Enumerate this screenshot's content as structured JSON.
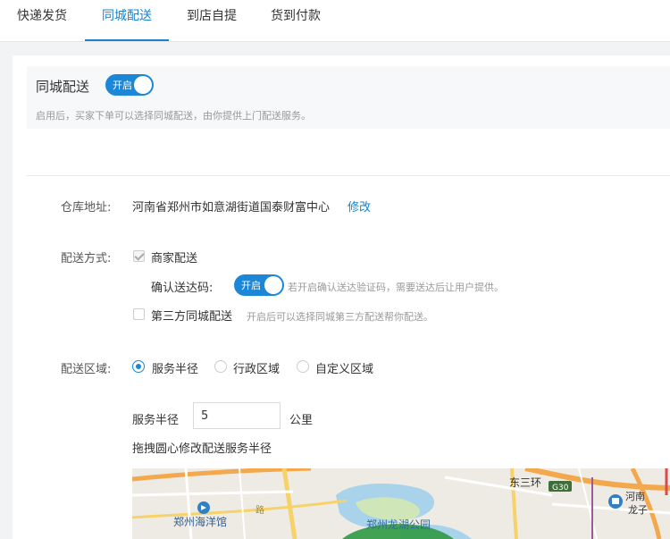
{
  "tabs": [
    {
      "label": "快递发货"
    },
    {
      "label": "同城配送"
    },
    {
      "label": "到店自提"
    },
    {
      "label": "货到付款"
    }
  ],
  "section": {
    "title": "同城配送",
    "switch_label": "开启",
    "description": "启用后，买家下单可以选择同城配送，由你提供上门配送服务。"
  },
  "warehouse": {
    "label": "仓库地址:",
    "address": "河南省郑州市如意湖街道国泰财富中心",
    "edit_link": "修改"
  },
  "delivery_method": {
    "label": "配送方式:",
    "merchant": "商家配送",
    "confirm_code_label": "确认送达码:",
    "confirm_switch_label": "开启",
    "confirm_hint": "若开启确认送达验证码，需要送达后让用户提供。",
    "third_party": "第三方同城配送",
    "third_party_hint": "开启后可以选择同城第三方配送帮你配送。"
  },
  "delivery_area": {
    "label": "配送区域:",
    "options": [
      {
        "label": "服务半径"
      },
      {
        "label": "行政区域"
      },
      {
        "label": "自定义区域"
      }
    ],
    "radius_label": "服务半径",
    "radius_value": "5",
    "radius_unit": "公里",
    "drag_hint": "拖拽圆心修改配送服务半径"
  },
  "map": {
    "labels": {
      "museum": "郑州海洋馆",
      "park": "郑州龙湖公园",
      "ring_road": "东三环",
      "highway": "G30",
      "province": "河南",
      "district": "龙子",
      "road_fragment": "路"
    }
  },
  "colors": {
    "accent": "#1a82c9",
    "switch": "#1b87d6"
  }
}
